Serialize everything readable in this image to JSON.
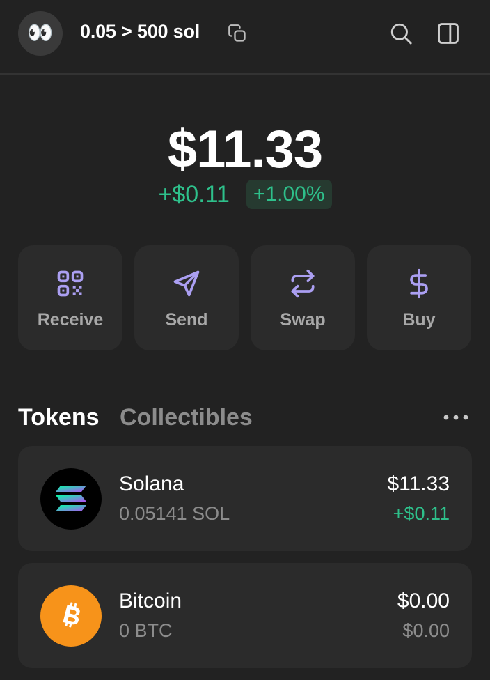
{
  "header": {
    "avatar_emoji": "👀",
    "account_name": "0.05 > 500 sol",
    "icons": [
      "copy-icon",
      "search-icon",
      "sidebar-icon"
    ]
  },
  "balance": {
    "total": "$11.33",
    "change_abs": "+$0.11",
    "change_pct": "+1.00%"
  },
  "actions": [
    {
      "label": "Receive",
      "icon": "qr-code-icon"
    },
    {
      "label": "Send",
      "icon": "send-icon"
    },
    {
      "label": "Swap",
      "icon": "swap-icon"
    },
    {
      "label": "Buy",
      "icon": "dollar-icon"
    }
  ],
  "tabs": {
    "tokens": "Tokens",
    "collectibles": "Collectibles",
    "active": "Tokens"
  },
  "tokens": [
    {
      "name": "Solana",
      "amount": "0.05141 SOL",
      "value": "$11.33",
      "change": "+$0.11",
      "change_color": "#2ec08b",
      "icon": "solana-logo-icon"
    },
    {
      "name": "Bitcoin",
      "amount": "0 BTC",
      "value": "$0.00",
      "change": "$0.00",
      "change_color": "#8c8c8c",
      "icon": "bitcoin-logo-icon"
    }
  ],
  "colors": {
    "background": "#222222",
    "card": "#2b2b2b",
    "accent": "#ab9ff2",
    "positive": "#2ec08b",
    "bitcoin": "#f7931a"
  }
}
